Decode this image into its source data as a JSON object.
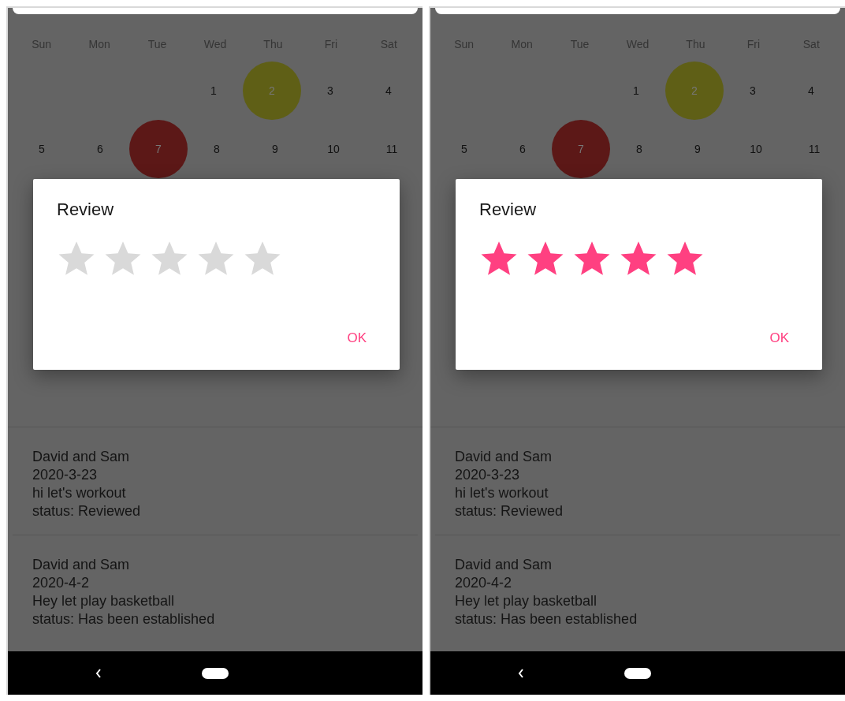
{
  "screens": [
    {
      "calendar": {
        "weekdays": [
          "Sun",
          "Mon",
          "Tue",
          "Wed",
          "Thu",
          "Fri",
          "Sat"
        ],
        "weeks": [
          [
            {
              "label": "1"
            },
            {
              "label": "2",
              "color": "#5f5f16"
            },
            {
              "label": "3"
            },
            {
              "label": "4"
            }
          ],
          [
            {
              "label": "5"
            },
            {
              "label": "6"
            },
            {
              "label": "7",
              "color": "#5c1817"
            },
            {
              "label": "8"
            },
            {
              "label": "9"
            },
            {
              "label": "10"
            },
            {
              "label": "11"
            }
          ]
        ]
      },
      "dialog": {
        "title": "Review",
        "stars": 0,
        "button": "OK"
      },
      "events": [
        {
          "title": "David and Sam",
          "date": "2020-3-23",
          "message": "hi let's workout",
          "status": "status: Reviewed"
        },
        {
          "title": "David and Sam",
          "date": "2020-4-2",
          "message": "Hey let play basketball",
          "status": "status: Has been established"
        }
      ]
    },
    {
      "calendar": {
        "weekdays": [
          "Sun",
          "Mon",
          "Tue",
          "Wed",
          "Thu",
          "Fri",
          "Sat"
        ],
        "weeks": [
          [
            {
              "label": "1"
            },
            {
              "label": "2",
              "color": "#5f5f16"
            },
            {
              "label": "3"
            },
            {
              "label": "4"
            }
          ],
          [
            {
              "label": "5"
            },
            {
              "label": "6"
            },
            {
              "label": "7",
              "color": "#5c1817"
            },
            {
              "label": "8"
            },
            {
              "label": "9"
            },
            {
              "label": "10"
            },
            {
              "label": "11"
            }
          ]
        ]
      },
      "dialog": {
        "title": "Review",
        "stars": 5,
        "button": "OK"
      },
      "events": [
        {
          "title": "David and Sam",
          "date": "2020-3-23",
          "message": "hi let's workout",
          "status": "status: Reviewed"
        },
        {
          "title": "David and Sam",
          "date": "2020-4-2",
          "message": "Hey let play basketball",
          "status": "status: Has been established"
        }
      ]
    }
  ]
}
